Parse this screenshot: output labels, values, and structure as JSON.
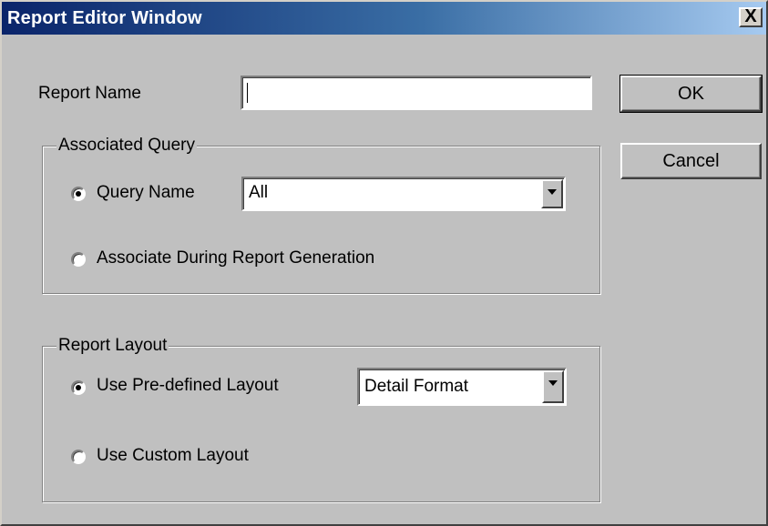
{
  "window": {
    "title": "Report Editor Window",
    "close_label": "X"
  },
  "report_name": {
    "label": "Report Name",
    "value": ""
  },
  "buttons": {
    "ok_label": "OK",
    "cancel_label": "Cancel"
  },
  "associated_query": {
    "legend": "Associated Query",
    "option_query_name": {
      "label": "Query Name",
      "selected": true
    },
    "query_select": {
      "value": "All"
    },
    "option_associate_during": {
      "label": "Associate During Report Generation",
      "selected": false
    }
  },
  "report_layout": {
    "legend": "Report Layout",
    "option_predefined": {
      "label": "Use Pre-defined Layout",
      "selected": true
    },
    "layout_select": {
      "value": "Detail Format"
    },
    "option_custom": {
      "label": "Use Custom Layout",
      "selected": false
    }
  },
  "colors": {
    "window_bg": "#c0c0c0",
    "titlebar_start": "#0a246a",
    "titlebar_end": "#a6caf0"
  }
}
